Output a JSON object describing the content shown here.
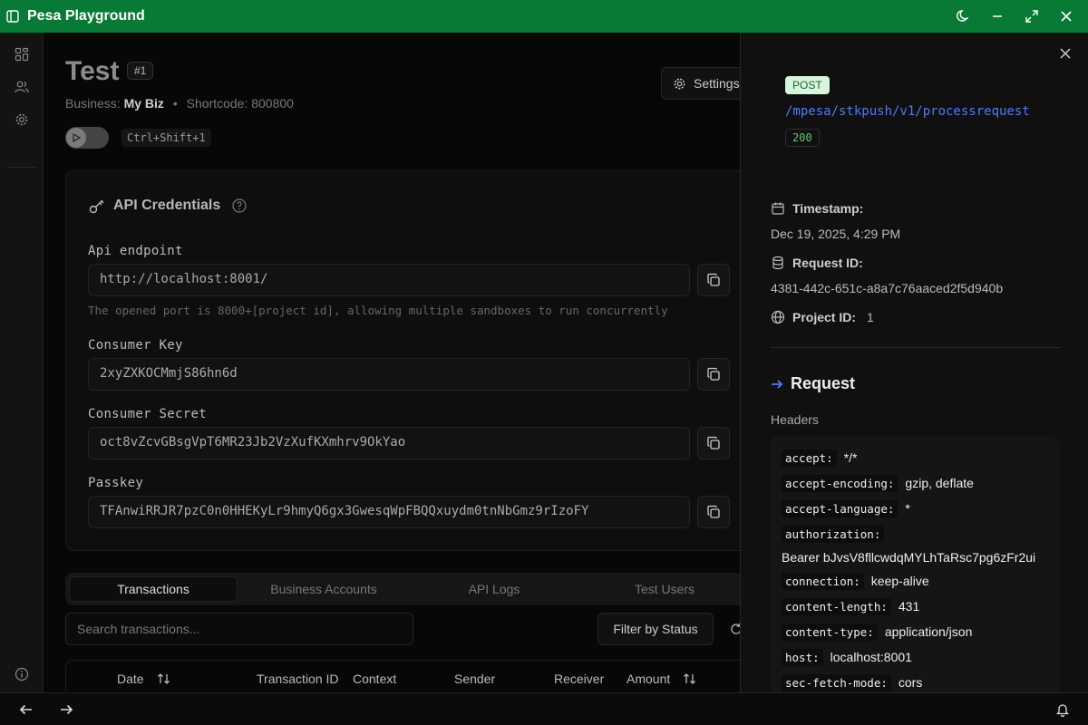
{
  "app": {
    "title": "Pesa Playground"
  },
  "page": {
    "title": "Test",
    "id_badge": "#1",
    "business_label": "Business:",
    "business_name": "My Biz",
    "shortcode_label": "Shortcode: 800800",
    "settings_label": "Settings",
    "shortcut": "Ctrl+Shift+1"
  },
  "credentials": {
    "title": "API Credentials",
    "api_endpoint_label": "Api endpoint",
    "api_endpoint_value": "http://localhost:8001/",
    "port_hint": "The opened port is 8000+[project id], allowing multiple sandboxes to run concurrently",
    "consumer_key_label": "Consumer Key",
    "consumer_key_value": "2xyZXKOCMmjS86hn6d",
    "consumer_secret_label": "Consumer Secret",
    "consumer_secret_value": "oct8vZcvGBsgVpT6MR23Jb2VzXufKXmhrv9OkYao",
    "passkey_label": "Passkey",
    "passkey_value": "TFAnwiRRJR7pzC0n0HHEKyLr9hmyQ6gx3GwesqWpFBQQxuydm0tnNbGmz9rIzoFY"
  },
  "tabs": [
    "Transactions",
    "Business Accounts",
    "API Logs",
    "Test Users"
  ],
  "search": {
    "placeholder": "Search transactions..."
  },
  "filter_label": "Filter by Status",
  "table": {
    "columns": [
      "Date",
      "Transaction ID",
      "Context",
      "Sender",
      "Receiver",
      "Amount"
    ]
  },
  "log_detail": {
    "method": "POST",
    "endpoint": "/mpesa/stkpush/v1/processrequest",
    "status": "200",
    "timestamp_label": "Timestamp:",
    "timestamp_value": "Dec 19, 2025, 4:29 PM",
    "request_id_label": "Request ID:",
    "request_id_value": "4381-442c-651c-a8a7c76aaced2f5d940b",
    "project_id_label": "Project ID:",
    "project_id_value": "1",
    "request_title": "Request",
    "headers_label": "Headers",
    "headers": [
      {
        "key": "accept:",
        "value": "*/*"
      },
      {
        "key": "accept-encoding:",
        "value": "gzip, deflate"
      },
      {
        "key": "accept-language:",
        "value": "*"
      },
      {
        "key": "authorization:",
        "value": "Bearer bJvsV8fllcwdqMYLhTaRsc7pg6zFr2ui"
      },
      {
        "key": "connection:",
        "value": "keep-alive"
      },
      {
        "key": "content-length:",
        "value": "431"
      },
      {
        "key": "content-type:",
        "value": "application/json"
      },
      {
        "key": "host:",
        "value": "localhost:8001"
      },
      {
        "key": "sec-fetch-mode:",
        "value": "cors"
      }
    ]
  },
  "colors": {
    "titlebar": "#087a35",
    "accent_blue": "#4c7cf5",
    "status_green": "#5fc77a"
  }
}
